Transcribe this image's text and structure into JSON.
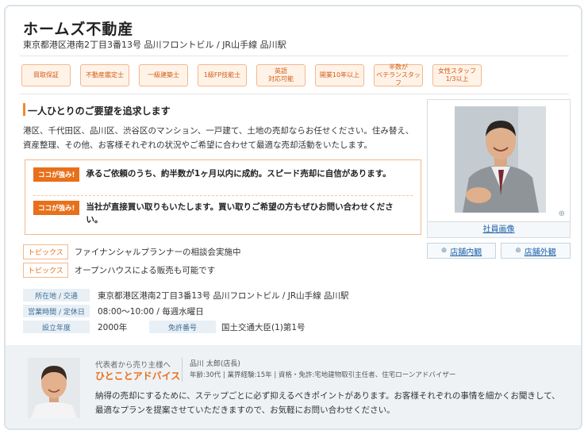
{
  "office": {
    "name": "ホームズ不動産",
    "address": "東京都港区港南2丁目3番13号 品川フロントビル / JR山手線 品川駅"
  },
  "badges": [
    "買取保証",
    "不動産鑑定士",
    "一級建築士",
    "1級FP技能士",
    "英語\n対応可能",
    "開業10年以上",
    "半数が\nベテランスタッフ",
    "女性スタッフ\n1/3以上"
  ],
  "intro": {
    "heading": "一人ひとりのご要望を追求します",
    "text": "港区、千代田区、品川区、渋谷区のマンション、一戸建て、土地の売却ならお任せください。住み替え、資産整理、その他、お客様それぞれの状況やご希望に合わせて最適な売却活動をいたします。"
  },
  "strengths": [
    {
      "tag": "ココが強み!",
      "text": "承るご依頼のうち、約半数が1ヶ月以内に成約。スピード売却に自信があります。"
    },
    {
      "tag": "ココが強み!",
      "text": "当社が直接買い取りもいたします。買い取りご希望の方もぜひお問い合わせください。"
    }
  ],
  "topics": [
    {
      "tag": "トピックス",
      "text": "ファイナンシャルプランナーの相談会実施中"
    },
    {
      "tag": "トピックス",
      "text": "オープンハウスによる販売も可能です"
    }
  ],
  "info": {
    "location_label": "所在地 / 交通",
    "location_value": "東京都港区港南2丁目3番13号 品川フロントビル / JR山手線 品川駅",
    "hours_label": "営業時間 / 定休日",
    "hours_value": "08:00〜10:00 / 毎週水曜日",
    "founded_label": "設立年度",
    "founded_value": "2000年",
    "license_label": "免許番号",
    "license_value": "国土交通大臣(1)第1号"
  },
  "photo": {
    "staff_link": "社員画像",
    "store_inside": "店舗内観",
    "store_outside": "店舗外観"
  },
  "advice": {
    "subtitle": "代表者から売り主様へ",
    "title": "ひとことアドバイス",
    "name": "品川 太郎(店長)",
    "career": "年齢:30代 | 業界経験:15年 | 資格・免許:宅地建物取引主任者、住宅ローンアドバイザー",
    "text": "納得の売却にするために、ステップごとに必ず抑えるべきポイントがあります。お客様それぞれの事情を細かくお聞きして、最適なプランを提案させていただきますので、お気軽にお問い合わせください。"
  },
  "colors": {
    "accent": "#e8701a",
    "link": "#1a5fa8",
    "label_bg": "#e8f0f6"
  }
}
